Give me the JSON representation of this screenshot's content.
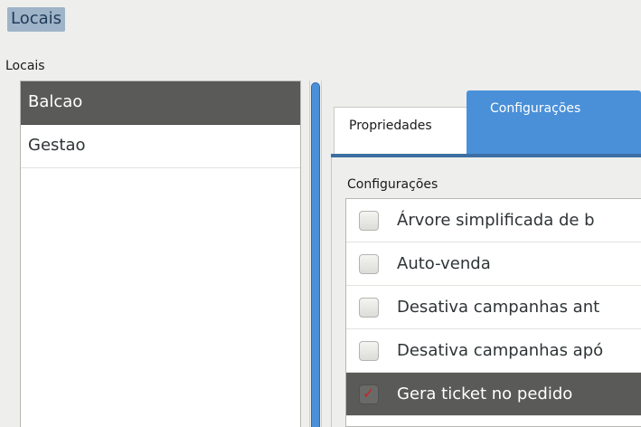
{
  "window": {
    "title": "Locais"
  },
  "locations": {
    "label": "Locais",
    "items": [
      {
        "label": "Balcao",
        "selected": true
      },
      {
        "label": "Gestao",
        "selected": false
      }
    ]
  },
  "tabs": [
    {
      "label": "Propriedades",
      "active": false
    },
    {
      "label": "Configurações",
      "active": true
    }
  ],
  "config": {
    "label": "Configurações",
    "items": [
      {
        "label": "Árvore simplificada de b",
        "checked": false,
        "selected": false
      },
      {
        "label": "Auto-venda",
        "checked": false,
        "selected": false
      },
      {
        "label": "Desativa campanhas ant",
        "checked": false,
        "selected": false
      },
      {
        "label": "Desativa campanhas apó",
        "checked": false,
        "selected": false
      },
      {
        "label": "Gera ticket no pedido",
        "checked": true,
        "selected": true
      }
    ]
  },
  "colors": {
    "accent": "#4a90d9",
    "selection": "#5a5a58",
    "check_mark": "#cc2222"
  },
  "icons": {
    "check_mark": "checkmark-icon"
  }
}
